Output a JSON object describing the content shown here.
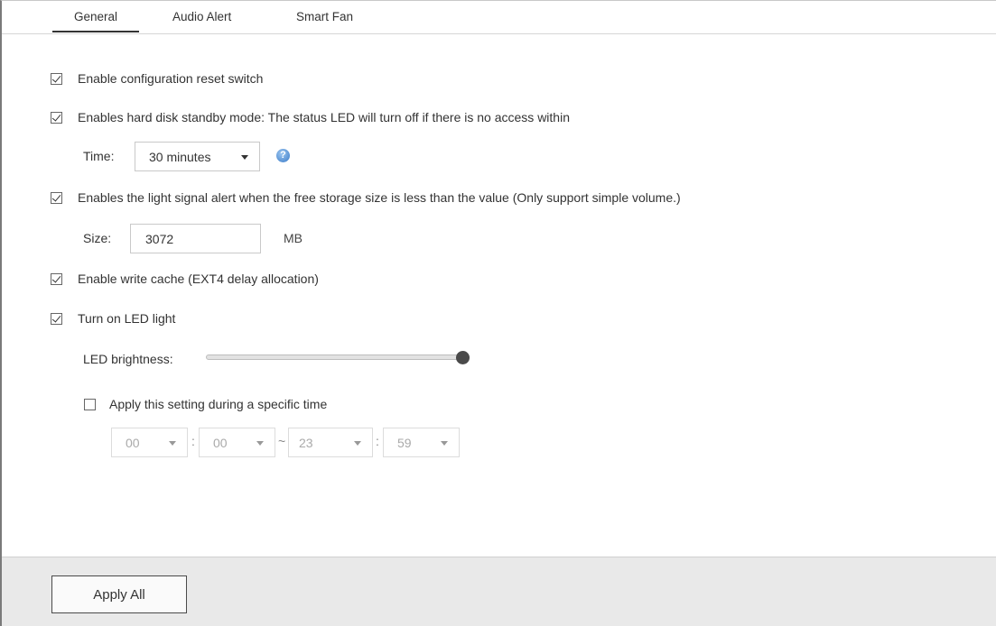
{
  "tabs": [
    {
      "label": "General",
      "active": true
    },
    {
      "label": "Audio Alert",
      "active": false
    },
    {
      "label": "Smart Fan",
      "active": false
    }
  ],
  "options": {
    "config_reset": {
      "label": "Enable configuration reset switch",
      "checked": true
    },
    "hdd_standby": {
      "label": "Enables hard disk standby mode: The status LED will turn off if there is no access within",
      "checked": true
    },
    "time_label": "Time:",
    "time_value": "30 minutes",
    "light_alert": {
      "label": "Enables the light signal alert when the free storage size is less than the value (Only support simple volume.)",
      "checked": true
    },
    "size_label": "Size:",
    "size_value": "3072",
    "size_unit": "MB",
    "write_cache": {
      "label": "Enable write cache (EXT4 delay allocation)",
      "checked": true
    },
    "led_light": {
      "label": "Turn on LED light",
      "checked": true
    },
    "led_brightness_label": "LED brightness:",
    "led_brightness_level": 1.0,
    "schedule": {
      "label": "Apply this setting during a specific time",
      "checked": false
    },
    "schedule_times": {
      "start_hour": "00",
      "start_minute": "00",
      "end_hour": "23",
      "end_minute": "59",
      "colon": ":",
      "tilde": "~"
    }
  },
  "footer": {
    "apply_label": "Apply All"
  },
  "icons": {
    "help": "help-icon",
    "dropdown": "chevron-down-icon"
  },
  "colors": {
    "help_icon": "#3a7bc8",
    "footer_bg": "#e9e9e9",
    "slider_thumb": "#4a4a4a"
  }
}
